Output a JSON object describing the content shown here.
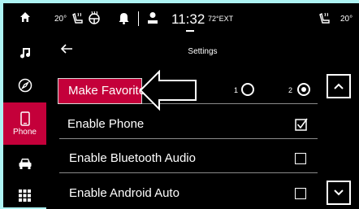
{
  "colors": {
    "accent": "#c4003a",
    "background": "#000000",
    "frame": "#aef3f3"
  },
  "status": {
    "left_temp": "20°",
    "time": "11:32",
    "ext_temp": "72°EXT",
    "right_temp": "20°",
    "icons": [
      "heated-seat-icon",
      "heated-wheel-icon",
      "bell-icon",
      "user-icon",
      "heated-seat-icon"
    ]
  },
  "sidebar": {
    "items": [
      {
        "name": "home",
        "icon": "home-icon",
        "label": ""
      },
      {
        "name": "music",
        "icon": "music-note-icon",
        "label": ""
      },
      {
        "name": "navigation",
        "icon": "compass-icon",
        "label": ""
      },
      {
        "name": "phone",
        "icon": "phone-icon",
        "label": "Phone",
        "active": true
      },
      {
        "name": "vehicle",
        "icon": "car-icon",
        "label": ""
      },
      {
        "name": "apps",
        "icon": "grid-icon",
        "label": ""
      }
    ]
  },
  "header": {
    "title": "Settings",
    "back_icon": "back-arrow-icon"
  },
  "rows": [
    {
      "label": "Make Favorite",
      "radio_options": [
        "1",
        "2"
      ],
      "selected": "2",
      "callout": "arrow-callout-icon"
    },
    {
      "label": "Enable Phone",
      "checked": true
    },
    {
      "label": "Enable Bluetooth Audio",
      "checked": false
    },
    {
      "label": "Enable Android Auto",
      "checked": false
    }
  ],
  "scroll": {
    "up_icon": "chevron-up-icon",
    "down_icon": "chevron-down-icon"
  }
}
